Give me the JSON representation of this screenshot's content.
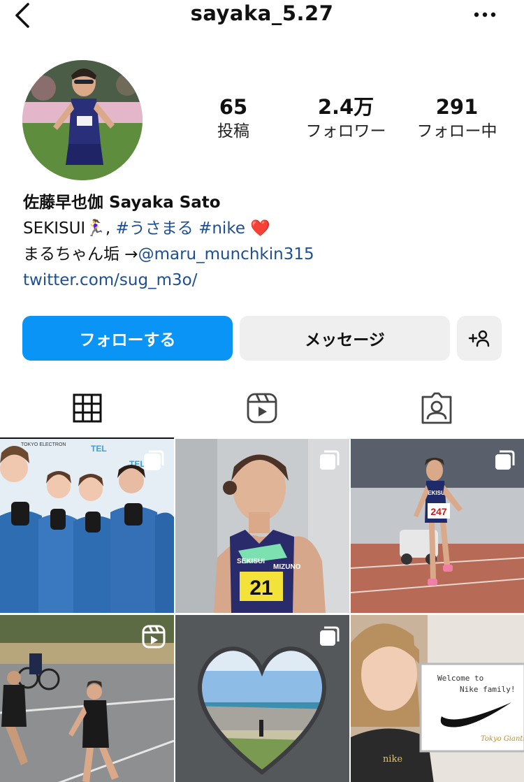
{
  "header": {
    "username": "sayaka_5.27"
  },
  "stats": {
    "posts": {
      "value": "65",
      "label": "投稿"
    },
    "followers": {
      "value": "2.4万",
      "label": "フォロワー"
    },
    "following": {
      "value": "291",
      "label": "フォロー中"
    }
  },
  "bio": {
    "name": "佐藤早也伽 Sayaka Sato",
    "line1_text": "SEKISUI🏃‍♀️,",
    "line1_tag1": "#うさまる",
    "line1_tag2": "#nike",
    "line1_heart": "❤️",
    "line2_text": "まるちゃん垢 →",
    "line2_mention": "@maru_munchkin315",
    "website": "twitter.com/sug_m3o/"
  },
  "actions": {
    "follow": "フォローする",
    "message": "メッセージ"
  },
  "posts": [
    {
      "type": "carousel"
    },
    {
      "type": "carousel"
    },
    {
      "type": "carousel"
    },
    {
      "type": "reel"
    },
    {
      "type": "carousel"
    },
    {
      "type": "photo"
    }
  ],
  "post_text": {
    "p0_logo": "TEL",
    "p0_banner": "TOKYO ELECTRON",
    "p1_team": "SEKISUI",
    "p1_brand": "MIZUNO",
    "p1_bib": "21",
    "p2_team": "SEKISUI",
    "p2_bib": "247",
    "p5_sign_line1": "Welcome to",
    "p5_sign_line2": "Nike family!",
    "p5_sign_line3": "Tokyo Giants",
    "p5_shirt": "nike"
  },
  "colors": {
    "accent": "#0a95f6",
    "link": "#1d4f91",
    "button_gray": "#efefef"
  }
}
